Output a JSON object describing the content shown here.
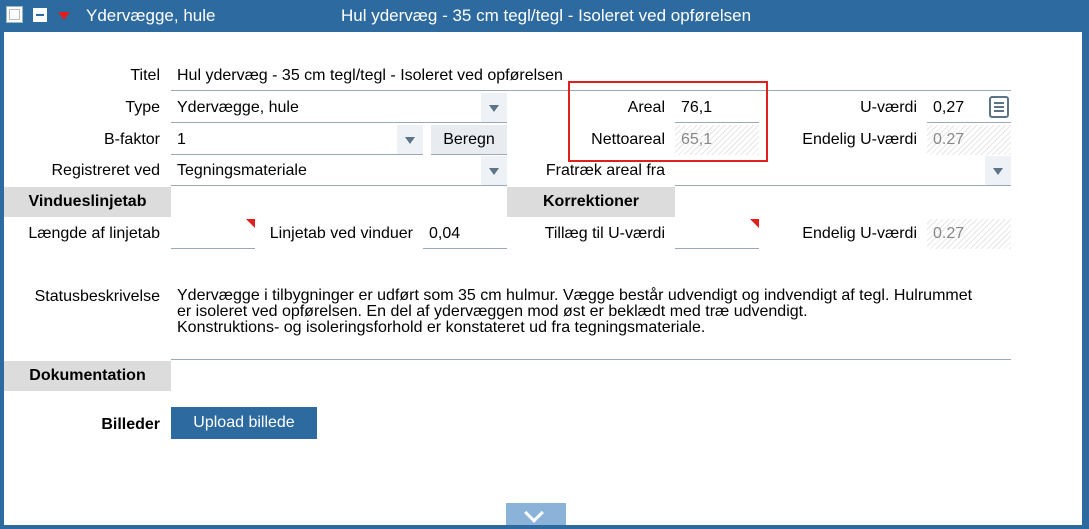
{
  "header": {
    "name": "Ydervægge, hule",
    "title": "Hul ydervæg - 35 cm tegl/tegl - Isoleret ved opførelsen"
  },
  "form": {
    "titel": {
      "label": "Titel",
      "value": "Hul ydervæg - 35 cm tegl/tegl - Isoleret ved opførelsen"
    },
    "type": {
      "label": "Type",
      "value": "Ydervægge, hule"
    },
    "bfaktor": {
      "label": "B-faktor",
      "value": "1"
    },
    "beregn": "Beregn",
    "registreret": {
      "label": "Registreret ved",
      "value": "Tegningsmateriale"
    },
    "areal": {
      "label": "Areal",
      "value": "76,1"
    },
    "nettoareal": {
      "label": "Nettoareal",
      "value": "65,1"
    },
    "fradrag": {
      "label": "Fratræk areal fra",
      "value": ""
    },
    "uvaerdi": {
      "label": "U-værdi",
      "value": "0,27"
    },
    "endelig_u": {
      "label": "Endelig U-værdi",
      "value": "0.27"
    }
  },
  "vindues": {
    "header": "Vindueslinjetab",
    "laengde": {
      "label": "Længde af linjetab",
      "value": ""
    },
    "linjetab": {
      "label": "Linjetab ved vinduer",
      "value": "0,04"
    }
  },
  "korrektioner": {
    "header": "Korrektioner",
    "tillaeg": {
      "label": "Tillæg til U-værdi",
      "value": ""
    },
    "endelig_u": {
      "label": "Endelig U-værdi",
      "value": "0.27"
    }
  },
  "status": {
    "label": "Statusbeskrivelse",
    "lines": [
      "Ydervægge i tilbygninger er udført som 35 cm hulmur. Vægge består udvendigt og indvendigt af tegl. Hulrummet",
      "er isoleret ved opførelsen. En del af ydervæggen mod øst er beklædt med træ udvendigt.",
      "Konstruktions- og isoleringsforhold er konstateret ud fra tegningsmateriale."
    ]
  },
  "dokumentation": {
    "header": "Dokumentation",
    "billeder_label": "Billeder",
    "upload_button": "Upload billede"
  },
  "colors": {
    "header_bg": "#2c6aa0",
    "highlight": "#e0201c",
    "section_bg": "#dcdcdc"
  }
}
